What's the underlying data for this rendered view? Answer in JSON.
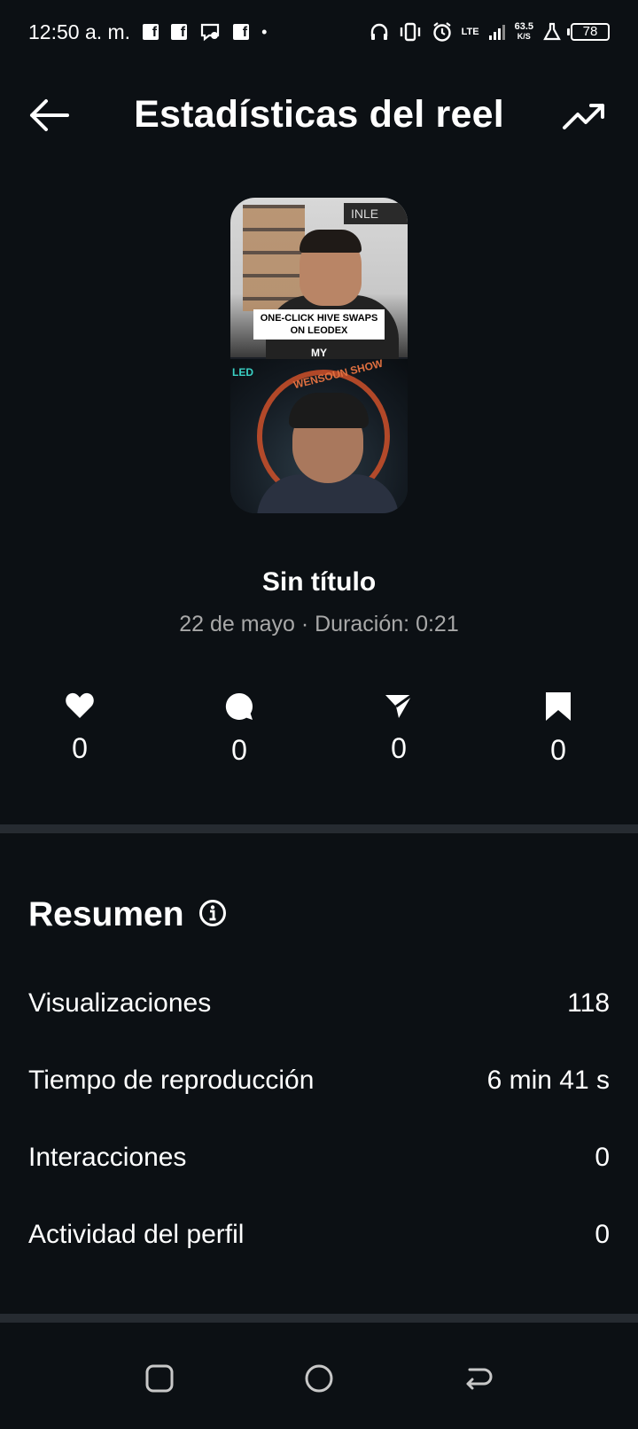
{
  "status_bar": {
    "time": "12:50 a. m.",
    "network_speed_value": "63.5",
    "network_speed_unit": "K/S",
    "network_type": "LTE",
    "battery": "78"
  },
  "header": {
    "title": "Estadísticas del reel"
  },
  "thumbnail": {
    "brand_text": "INLE",
    "caption_line1": "ONE-CLICK HIVE SWAPS",
    "caption_line2": "ON LEODEX",
    "caption_my": "MY",
    "logo_text": "LED",
    "ring_text": "WENSOUN SHOW"
  },
  "reel": {
    "title": "Sin título",
    "meta": "22 de mayo · Duración: 0:21"
  },
  "stats": {
    "likes": "0",
    "comments": "0",
    "shares": "0",
    "saves": "0"
  },
  "summary": {
    "title": "Resumen",
    "rows": [
      {
        "label": "Visualizaciones",
        "value": "118"
      },
      {
        "label": "Tiempo de reproducción",
        "value": "6 min 41 s"
      },
      {
        "label": "Interacciones",
        "value": "0"
      },
      {
        "label": "Actividad del perfil",
        "value": "0"
      }
    ]
  },
  "colors": {
    "background": "#0c1014",
    "divider": "#262b31",
    "secondary_text": "#a8a8a8"
  }
}
